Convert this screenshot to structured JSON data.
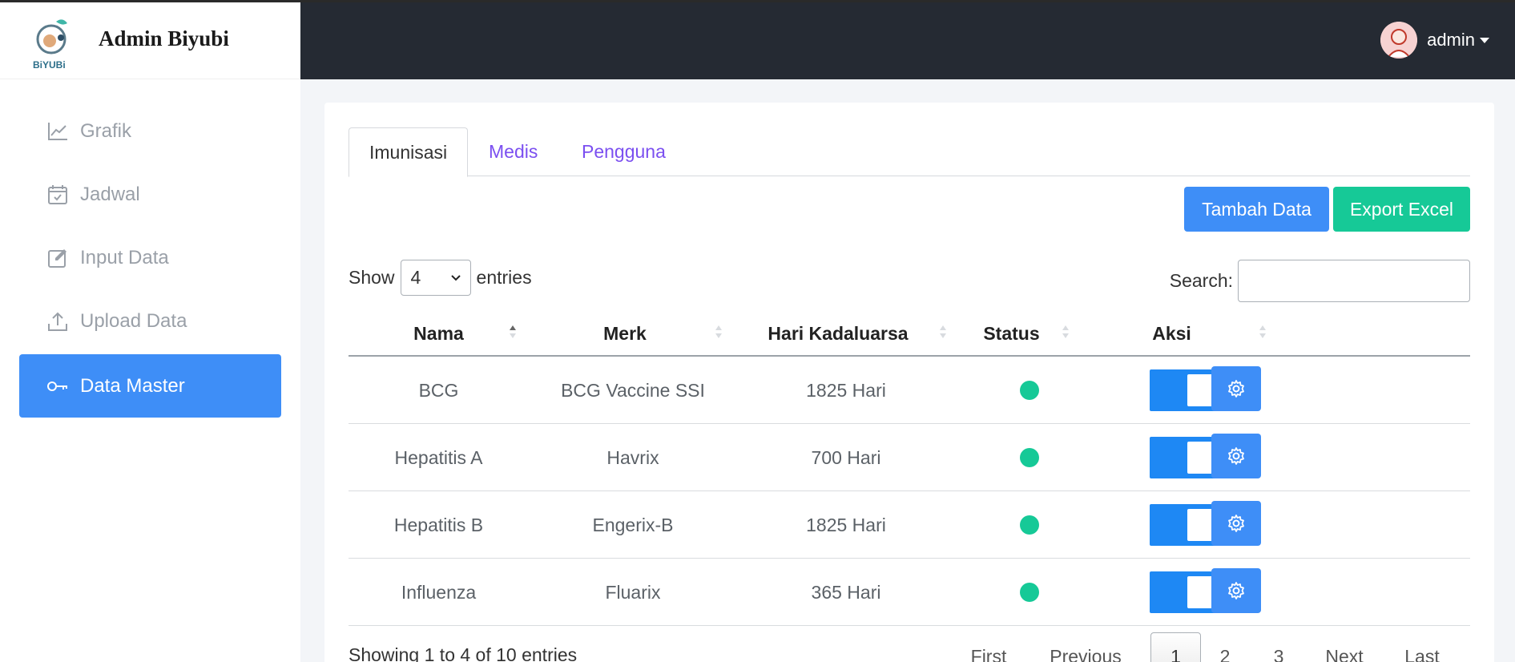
{
  "sidebar": {
    "brand_title": "Admin Biyubi",
    "logo_text": "BiYUBi",
    "items": [
      {
        "label": "Grafik",
        "icon": "chart-line-icon"
      },
      {
        "label": "Jadwal",
        "icon": "calendar-check-icon"
      },
      {
        "label": "Input Data",
        "icon": "edit-icon"
      },
      {
        "label": "Upload Data",
        "icon": "upload-icon"
      },
      {
        "label": "Data Master",
        "icon": "key-icon",
        "active": true
      }
    ]
  },
  "header": {
    "user_name": "admin"
  },
  "tabs": [
    {
      "label": "Imunisasi",
      "active": true
    },
    {
      "label": "Medis"
    },
    {
      "label": "Pengguna"
    }
  ],
  "toolbar": {
    "add_label": "Tambah Data",
    "export_label": "Export Excel"
  },
  "entries": {
    "show_label": "Show",
    "value": "4",
    "suffix_label": "entries",
    "search_label": "Search:",
    "search_value": ""
  },
  "table": {
    "columns": [
      "Nama",
      "Merk",
      "Hari Kadaluarsa",
      "Status",
      "Aksi"
    ],
    "rows": [
      {
        "nama": "BCG",
        "merk": "BCG Vaccine SSI",
        "hari": "1825 Hari",
        "status": "active"
      },
      {
        "nama": "Hepatitis A",
        "merk": "Havrix",
        "hari": "700 Hari",
        "status": "active"
      },
      {
        "nama": "Hepatitis B",
        "merk": "Engerix-B",
        "hari": "1825 Hari",
        "status": "active"
      },
      {
        "nama": "Influenza",
        "merk": "Fluarix",
        "hari": "365 Hari",
        "status": "active"
      }
    ]
  },
  "pagination": {
    "info": "Showing 1 to 4 of 10 entries",
    "first": "First",
    "previous": "Previous",
    "pages": [
      "1",
      "2",
      "3"
    ],
    "next": "Next",
    "last": "Last"
  },
  "colors": {
    "accent": "#3e8ef7",
    "success": "#16c997",
    "header": "#252a33",
    "tab_link": "#7b4ff0"
  }
}
